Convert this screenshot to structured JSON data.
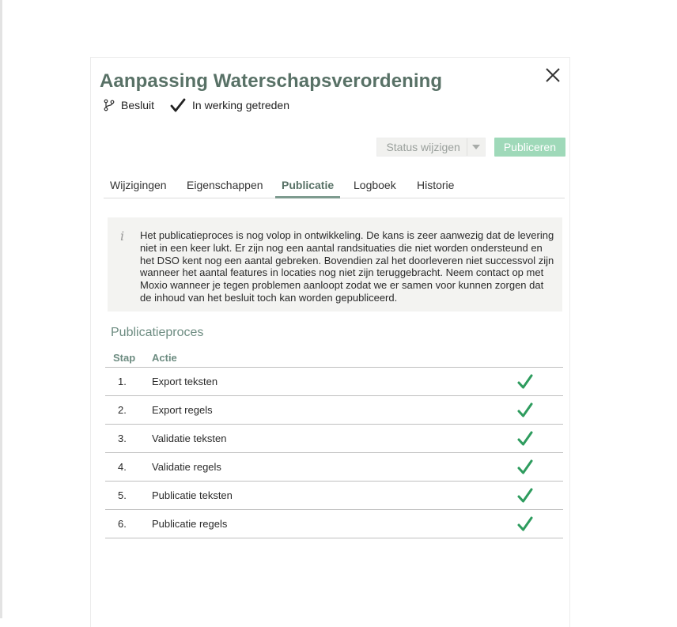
{
  "dialog": {
    "title": "Aanpassing Waterschapsverordening",
    "meta": {
      "type_label": "Besluit",
      "type_icon": "branch-icon",
      "status_label": "In werking getreden",
      "status_icon": "checkmark-icon"
    },
    "actions": {
      "status_label": "Status wijzigen",
      "publish_label": "Publiceren"
    },
    "tabs": [
      {
        "label": "Wijzigingen",
        "active": false
      },
      {
        "label": "Eigenschappen",
        "active": false
      },
      {
        "label": "Publicatie",
        "active": true
      },
      {
        "label": "Logboek",
        "active": false
      },
      {
        "label": "Historie",
        "active": false
      }
    ],
    "info": {
      "icon": "i",
      "text": "Het publicatieproces is nog volop in ontwikkeling. De kans is zeer aanwezig dat de levering niet in een keer lukt. Er zijn nog een aantal randsituaties die niet worden ondersteund en het DSO kent nog een aantal gebreken. Bovendien zal het doorleveren niet successvol zijn wanneer het aantal features in locaties nog niet zijn teruggebracht. Neem contact op met Moxio wanneer je tegen problemen aanloopt zodat we er samen voor kunnen zorgen dat de inhoud van het besluit toch kan worden gepubliceerd."
    },
    "process": {
      "title": "Publicatieproces",
      "headers": {
        "step": "Stap",
        "action": "Actie"
      },
      "rows": [
        {
          "step": "1.",
          "action": "Export teksten",
          "done": true
        },
        {
          "step": "2.",
          "action": "Export regels",
          "done": true
        },
        {
          "step": "3.",
          "action": "Validatie teksten",
          "done": true
        },
        {
          "step": "4.",
          "action": "Validatie regels",
          "done": true
        },
        {
          "step": "5.",
          "action": "Publicatie teksten",
          "done": true
        },
        {
          "step": "6.",
          "action": "Publicatie regels",
          "done": true
        }
      ]
    }
  },
  "colors": {
    "title": "#587166",
    "accent": "#6d8c81",
    "publish_button": "#9fd9b9",
    "check": "#2e9c5e"
  }
}
